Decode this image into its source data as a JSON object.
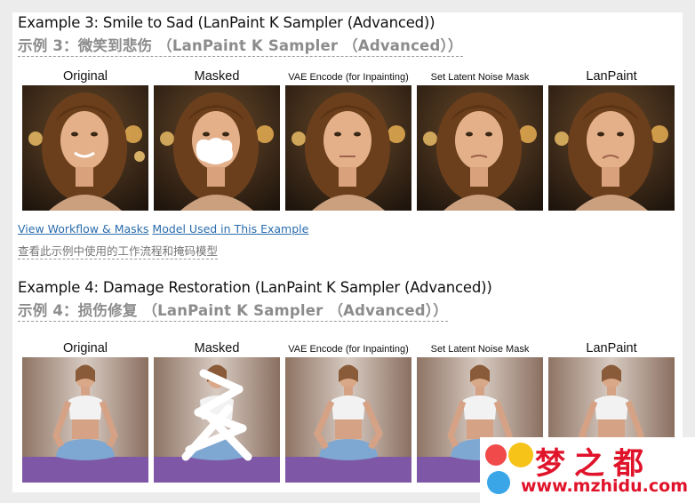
{
  "example3": {
    "title_en": "Example 3: Smile to Sad (LanPaint K Sampler (Advanced))",
    "title_zh": "示例 3：微笑到悲伤 （LanPaint K Sampler （Advanced））",
    "captions": [
      "Original",
      "Masked",
      "VAE Encode (for Inpainting)",
      "Set Latent Noise Mask",
      "LanPaint"
    ],
    "link_workflow": "View Workflow & Masks",
    "link_model": "Model Used in This Example",
    "links_zh": "查看此示例中使用的工作流程和掩码模型"
  },
  "example4": {
    "title_en": "Example 4: Damage Restoration (LanPaint K Sampler (Advanced))",
    "title_zh": "示例 4：损伤修复 （LanPaint K Sampler （Advanced））",
    "captions": [
      "Original",
      "Masked",
      "VAE Encode (for Inpainting)",
      "Set Latent Noise Mask",
      "LanPaint"
    ]
  },
  "watermark": {
    "brand_zh": "梦之都",
    "url": "www.mzhidu.com",
    "colors": {
      "text": "#e0132a",
      "face1": "#f04a4a",
      "face2": "#f6c318",
      "face3": "#3aa6e8"
    }
  },
  "colors": {
    "link": "#2a6cad",
    "zh_heading": "#8c8c8c",
    "page_bg": "#ffffff",
    "outer_bg": "#ececec"
  }
}
